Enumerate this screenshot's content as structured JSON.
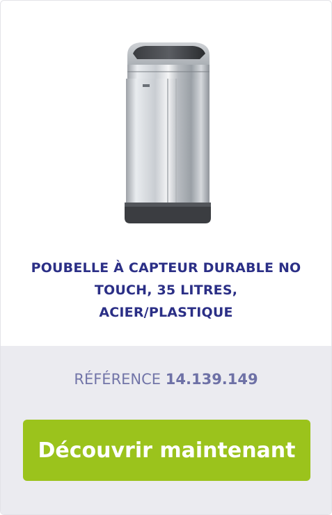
{
  "product": {
    "image_icon": "stainless-steel-sensor-bin",
    "title_line1": "POUBELLE À CAPTEUR DURABLE NO",
    "title_line2": "TOUCH, 35 LITRES,",
    "title_line3": "ACIER/PLASTIQUE",
    "reference_label": "RÉFÉRENCE",
    "reference_value": "14.139.149",
    "cta_label": "Découvrir maintenant"
  },
  "colors": {
    "title": "#2b2f86",
    "reference": "#7275a8",
    "footer_background": "#ebebf0",
    "cta_background": "#9bc31c"
  }
}
